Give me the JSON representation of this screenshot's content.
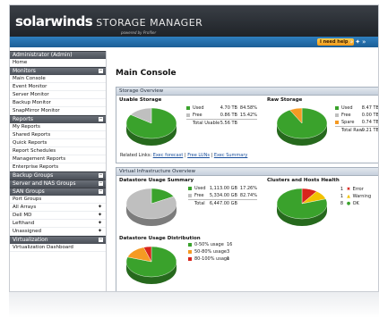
{
  "header": {
    "brand_prefix": "solarwinds",
    "product": "STORAGE MANAGER",
    "powered_by": "powered by Profiler"
  },
  "toolbar": {
    "help_label": "I need help ›",
    "icons": [
      "arrows-icon",
      "star-icon",
      "settings-icon"
    ]
  },
  "sidebar": {
    "admin_title": "Administrator (Admin)",
    "home": "Home",
    "monitors": {
      "title": "Monitors",
      "items": [
        "Main Console",
        "Event Monitor",
        "Server Monitor",
        "Backup Monitor",
        "SnapMirror Monitor"
      ]
    },
    "reports": {
      "title": "Reports",
      "items": [
        "My Reports",
        "Shared Reports",
        "Quick Reports",
        "Report Schedules",
        "Management Reports",
        "Enterprise Reports"
      ]
    },
    "backup_groups": "Backup Groups",
    "server_nas_groups": "Server and NAS Groups",
    "san_groups": {
      "title": "SAN Groups",
      "items": [
        "Port Groups",
        "All Arrays",
        "Dell MD",
        "Lefthand",
        "Unassigned"
      ]
    },
    "virtualization": {
      "title": "Virtualization",
      "items": [
        "Virtualization Dashboard"
      ]
    }
  },
  "main": {
    "title": "Main Console",
    "storage_overview": {
      "title": "Storage Overview",
      "usable_title": "Usable Storage",
      "raw_title": "Raw Storage",
      "usable_legend": [
        {
          "label": "Used",
          "value": "4.70 TB",
          "pct": "84.58%",
          "color": "#3aa22c"
        },
        {
          "label": "Free",
          "value": "0.86 TB",
          "pct": "15.42%",
          "color": "#bfbfbf"
        }
      ],
      "usable_total_label": "Total Usable",
      "usable_total_value": "5.56 TB",
      "raw_legend": [
        {
          "label": "Used",
          "value": "8.47 TB",
          "color": "#3aa22c"
        },
        {
          "label": "Free",
          "value": "0.00 TB",
          "color": "#bfbfbf"
        },
        {
          "label": "Spare",
          "value": "0.74 TB",
          "color": "#f59a23"
        }
      ],
      "raw_total_label": "Total Raw",
      "raw_total_value": "9.21 TB",
      "related_label": "Related Links:",
      "related_links": [
        "Exec forecast",
        "Free LUNs",
        "Exec Summary"
      ],
      "related_sep": " | "
    },
    "virtual_overview": {
      "title": "Virtual Infrastructure Overview",
      "datastore_title": "Datastore Usage Summary",
      "datastore_legend": [
        {
          "label": "Used",
          "value": "1,113.00 GB",
          "pct": "17.26%",
          "color": "#3aa22c"
        },
        {
          "label": "Free",
          "value": "5,334.00 GB",
          "pct": "82.74%",
          "color": "#bfbfbf"
        }
      ],
      "datastore_total_label": "Total",
      "datastore_total_value": "6,447.00 GB",
      "clusters_title": "Clusters and Hosts Health",
      "health": [
        {
          "icon": "error-icon",
          "glyph": "✖",
          "label": "Error",
          "count": "1",
          "color": "#d8241c"
        },
        {
          "icon": "warning-icon",
          "glyph": "▲",
          "label": "Warning",
          "count": "1",
          "color": "#f2c200"
        },
        {
          "icon": "ok-icon",
          "glyph": "●",
          "label": "OK",
          "count": "8",
          "color": "#3aa22c"
        }
      ],
      "distribution_title": "Datastore Usage Distribution",
      "distribution": [
        {
          "label": "0-50% usage",
          "count": "16",
          "color": "#3aa22c"
        },
        {
          "label": "50-80% usage",
          "count": "3",
          "color": "#f59a23"
        },
        {
          "label": "80-100% usage",
          "count": "1",
          "color": "#d8241c"
        }
      ]
    }
  },
  "chart_data": [
    {
      "type": "pie",
      "title": "Usable Storage",
      "categories": [
        "Used",
        "Free"
      ],
      "values": [
        84.58,
        15.42
      ]
    },
    {
      "type": "pie",
      "title": "Raw Storage",
      "categories": [
        "Used",
        "Free",
        "Spare"
      ],
      "values": [
        8.47,
        0.0,
        0.74
      ]
    },
    {
      "type": "pie",
      "title": "Datastore Usage Summary",
      "categories": [
        "Used",
        "Free"
      ],
      "values": [
        17.26,
        82.74
      ]
    },
    {
      "type": "pie",
      "title": "Clusters and Hosts Health",
      "categories": [
        "Error",
        "Warning",
        "OK"
      ],
      "values": [
        1,
        1,
        8
      ]
    },
    {
      "type": "pie",
      "title": "Datastore Usage Distribution",
      "categories": [
        "0-50% usage",
        "50-80% usage",
        "80-100% usage"
      ],
      "values": [
        16,
        3,
        1
      ]
    }
  ]
}
